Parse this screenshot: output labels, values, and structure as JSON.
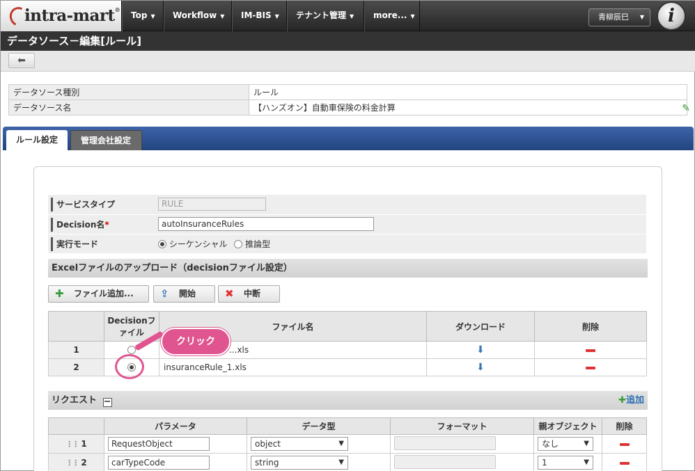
{
  "nav": {
    "items": [
      {
        "label": "Top"
      },
      {
        "label": "Workflow"
      },
      {
        "label": "IM-BIS"
      },
      {
        "label": "テナント管理"
      },
      {
        "label": "more..."
      }
    ],
    "user": "青柳辰巳"
  },
  "page": {
    "title": "データソース－編集[ルール]"
  },
  "info": {
    "rows": [
      {
        "label": "データソース種別",
        "value": "ルール"
      },
      {
        "label": "データソース名",
        "value": "【ハンズオン】自動車保険の料金計算"
      }
    ]
  },
  "tabs": [
    {
      "label": "ルール設定"
    },
    {
      "label": "管理会社設定"
    }
  ],
  "form": {
    "service_type_label": "サービスタイプ",
    "service_type_value": "RULE",
    "decision_name_label": "Decision名",
    "required_mark": "*",
    "decision_name_value": "autoInsuranceRules",
    "mode_label": "実行モード",
    "mode_options": [
      "シーケンシャル",
      "推論型"
    ],
    "mode_selected": "シーケンシャル"
  },
  "upload": {
    "heading": "Excelファイルのアップロード（decisionファイル設定）",
    "buttons": {
      "add": "ファイル追加...",
      "start": "開始",
      "stop": "中断"
    },
    "columns": [
      "",
      "Decisionファイル",
      "ファイル名",
      "ダウンロード",
      "削除"
    ],
    "rows": [
      {
        "no": "1",
        "file": "...xls",
        "selected": false
      },
      {
        "no": "2",
        "file": "insuranceRule_1.xls",
        "selected": true
      }
    ]
  },
  "callout": {
    "text": "クリック"
  },
  "request": {
    "heading": "リクエスト",
    "add_label": "追加",
    "columns": [
      "",
      "パラメータ",
      "データ型",
      "フォーマット",
      "親オブジェクト",
      "削除"
    ],
    "rows": [
      {
        "no": "1",
        "param": "RequestObject",
        "type": "object",
        "parent": "なし"
      },
      {
        "no": "2",
        "param": "carTypeCode",
        "type": "string",
        "parent": "1"
      }
    ]
  },
  "colors": {
    "accent": "#e0558f",
    "tab_band": "#2d4f8e",
    "delete": "#d33333"
  }
}
